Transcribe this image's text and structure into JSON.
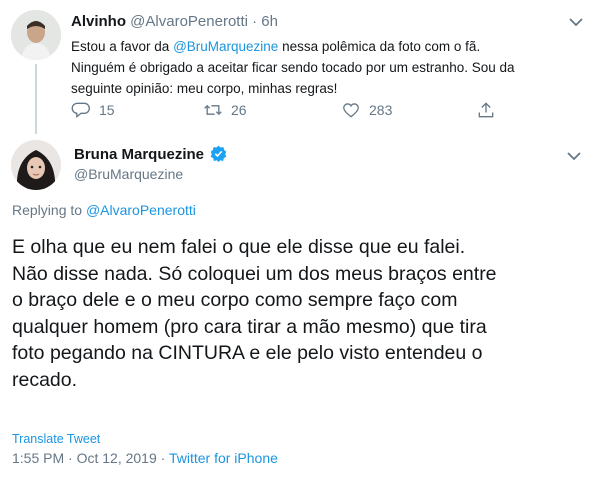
{
  "parent_tweet": {
    "display_name": "Alvinho",
    "handle": "@AlvaroPenerotti",
    "separator": "·",
    "time": "6h",
    "text_before_mention": "Estou a favor da ",
    "mention": "@BruMarquezine",
    "text_line1_after": " nessa polêmica da foto com o fã.",
    "text_line2": "Ninguém é obrigado a aceitar ficar sendo tocado por um estranho. Sou da",
    "text_line3": "seguinte opinião: meu corpo, minhas regras!",
    "actions": {
      "reply_icon": "reply-icon",
      "reply_count": "15",
      "retweet_icon": "retweet-icon",
      "retweet_count": "26",
      "like_icon": "heart-icon",
      "like_count": "283",
      "share_icon": "share-icon"
    }
  },
  "main_tweet": {
    "display_name": "Bruna Marquezine",
    "verified_icon": "verified-badge-icon",
    "handle": "@BruMarquezine",
    "replying_to_label": "Replying to ",
    "replying_to_handle": "@AlvaroPenerotti",
    "text_lines": [
      "E olha que eu nem falei o que ele disse que eu falei.",
      "Não disse nada. Só coloquei um dos meus braços entre",
      "o braço dele e o meu corpo como sempre faço com",
      "qualquer homem (pro cara tirar a mão mesmo) que tira",
      "foto pegando na CINTURA e ele pelo visto entendeu o",
      "recado."
    ],
    "translate_label": "Translate Tweet",
    "timestamp": "1:55 PM · Oct 12, 2019",
    "meta_separator": " · ",
    "source": "Twitter for iPhone"
  },
  "colors": {
    "link": "#1b95e0",
    "muted": "#657786",
    "verified": "#1da1f2"
  }
}
